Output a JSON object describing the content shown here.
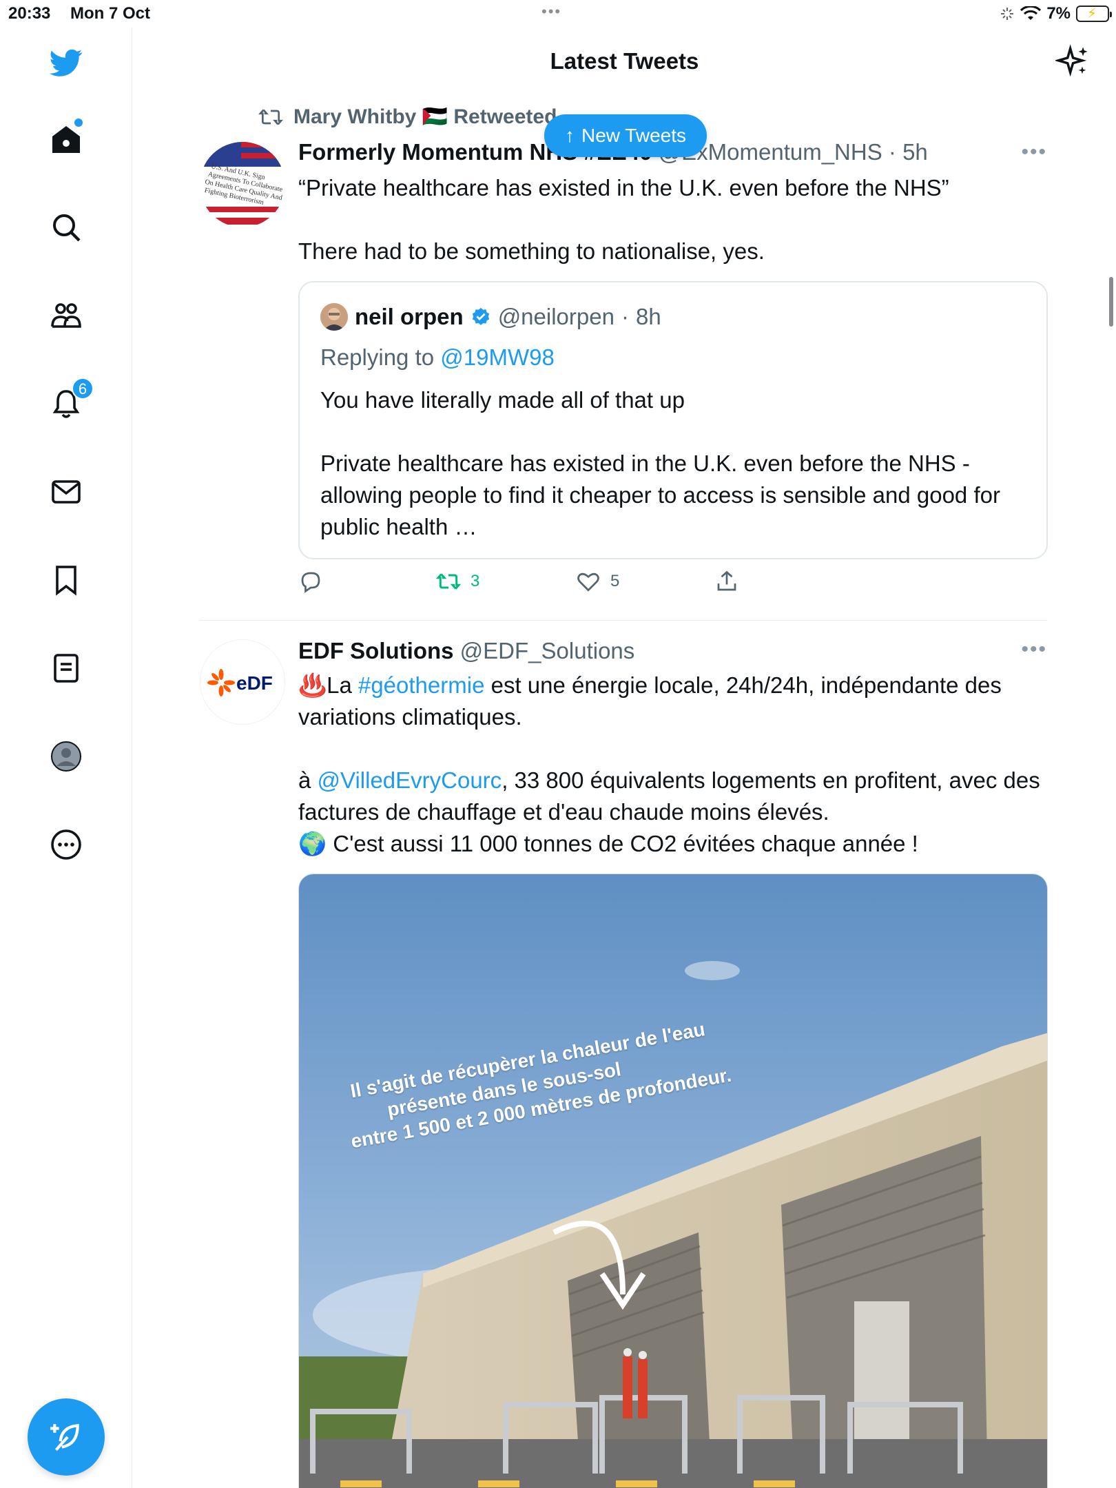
{
  "status_bar": {
    "time": "20:33",
    "date": "Mon 7 Oct",
    "battery": "7%"
  },
  "sidebar": {
    "notification_count": "6"
  },
  "header": {
    "title": "Latest Tweets"
  },
  "new_tweets_label": "New Tweets",
  "colors": {
    "accent": "#1d9bf0",
    "retweet_green": "#00ba7c",
    "muted": "#536471"
  },
  "tweet1": {
    "retweeted_by": "Mary Whitby 🇵🇸 Retweeted",
    "name": "Formerly Momentum NHS #EE40",
    "handle": "@ExMomentum_NHS",
    "time": "5h",
    "text": "“Private healthcare has existed in the U.K. even before the NHS”\n\nThere had to be something to nationalise, yes.",
    "quote": {
      "name": "neil orpen",
      "handle": "@neilorpen",
      "time": "8h",
      "replying_prefix": "Replying to",
      "replying_to": "@19MW98",
      "text": "You have literally made all of that up\n\nPrivate healthcare has existed in the U.K. even before the NHS - allowing people to find it cheaper to access is sensible and good for public health …"
    },
    "retweets": "3",
    "likes": "5"
  },
  "tweet2": {
    "name": "EDF Solutions",
    "handle": "@EDF_Solutions",
    "avatar_text": "eDF",
    "text_p1_emoji": "♨️",
    "text_p1_a": "La ",
    "text_p1_tag": "#géothermie",
    "text_p1_b": " est une énergie locale, 24h/24h, indépendante des variations climatiques.",
    "text_p2_a": "à ",
    "text_p2_mention": "@VilledEvryCourc",
    "text_p2_b": ", 33 800 équivalents logements en profitent, avec des factures de chauffage et d'eau chaude moins élevés.",
    "text_p3": "🌍 C'est aussi 11 000 tonnes de CO2 évitées chaque année !",
    "media_caption_1": "Il s'agit de récupèrer la chaleur de l'eau",
    "media_caption_2": "présente dans le sous-sol",
    "media_caption_3": "entre 1 500 et 2 000 mètres de profondeur."
  }
}
